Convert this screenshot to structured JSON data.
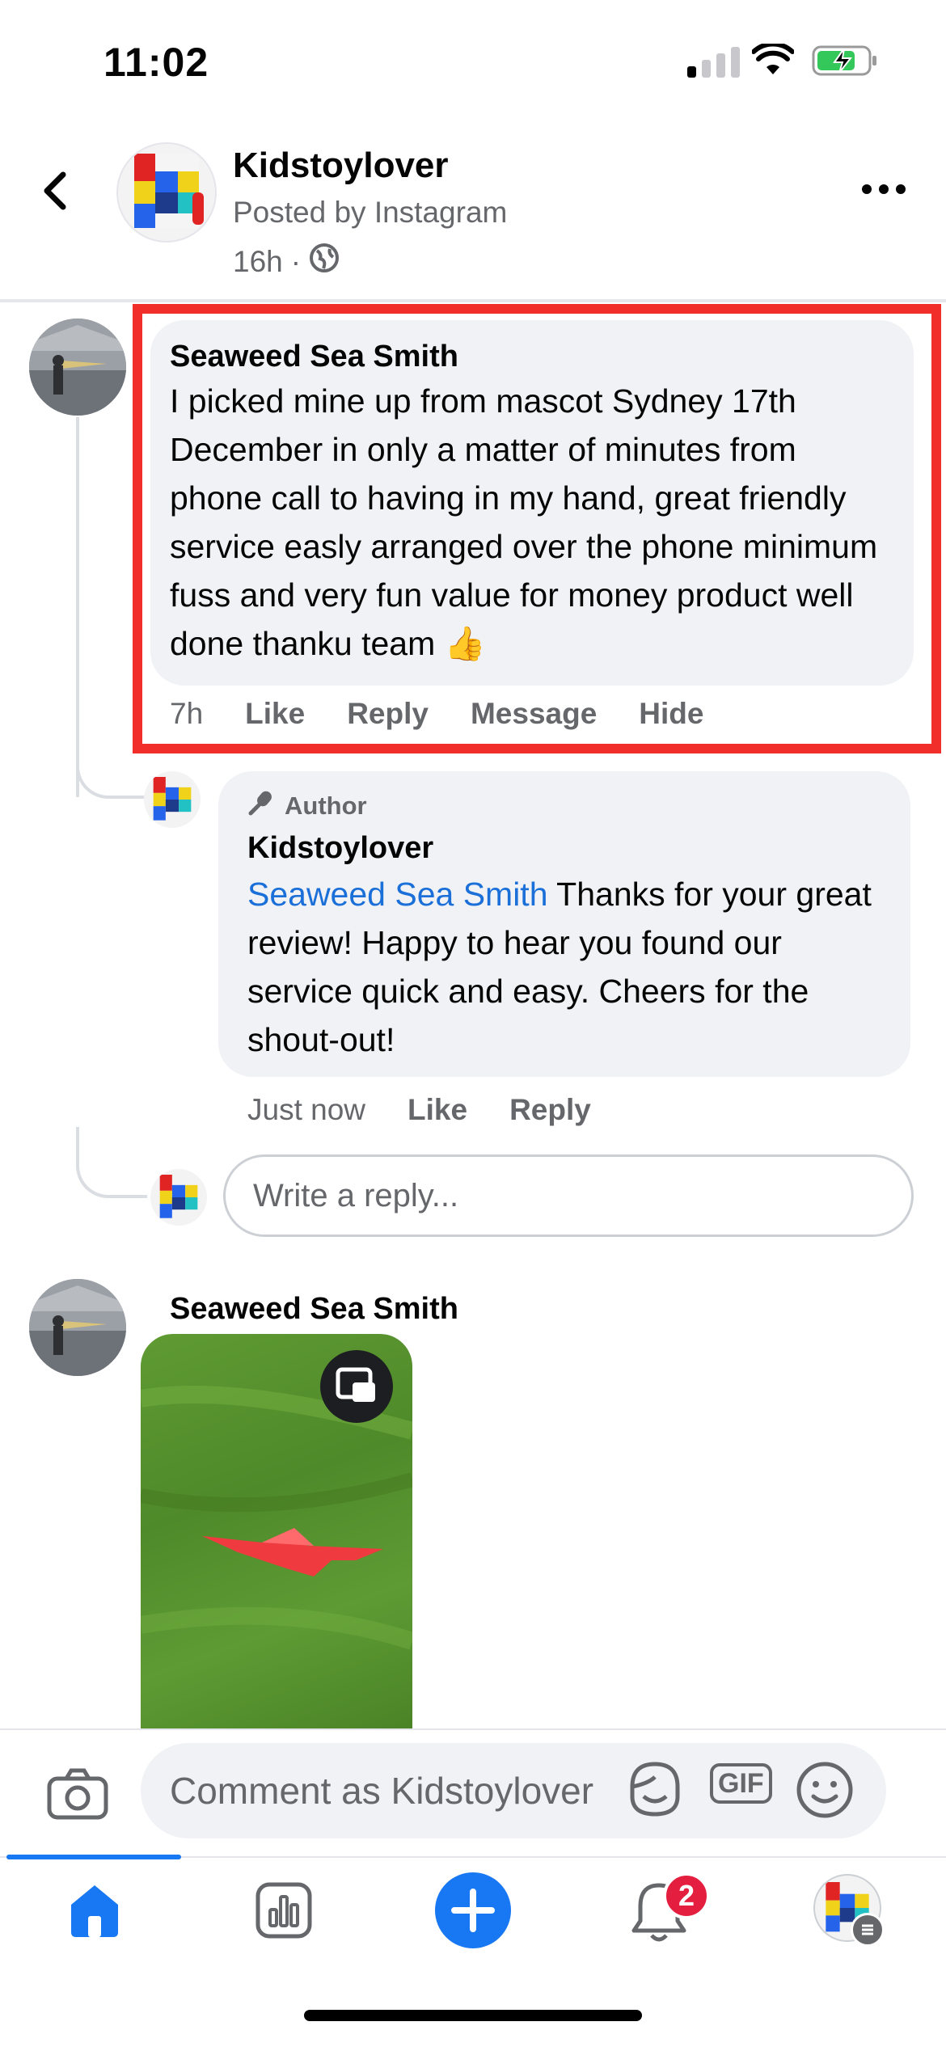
{
  "status_bar": {
    "time": "11:02"
  },
  "header": {
    "page_name": "Kidstoylover",
    "posted_by": "Posted by Instagram",
    "time": "16h",
    "separator": "·"
  },
  "comments": [
    {
      "author": "Seaweed Sea Smith",
      "text": "I picked mine up from mascot Sydney 17th December in only a matter of minutes from phone call to having in my hand, great friendly service easly arranged over the phone minimum fuss and very fun value for money product well done thanku team 👍",
      "time": "7h",
      "actions": [
        "Like",
        "Reply",
        "Message",
        "Hide"
      ]
    },
    {
      "author_tag": "Author",
      "author": "Kidstoylover",
      "mention": "Seaweed Sea Smith",
      "text": " Thanks for your great review! Happy to hear you found our service quick and easy. Cheers for the shout-out!",
      "time": "Just now",
      "actions": [
        "Like",
        "Reply"
      ]
    },
    {
      "author": "Seaweed Sea Smith"
    }
  ],
  "reply_input": {
    "placeholder": "Write a reply..."
  },
  "composer": {
    "placeholder": "Comment as Kidstoylover",
    "gif_label": "GIF"
  },
  "tabbar": {
    "notifications_count": "2"
  },
  "colors": {
    "accent": "#1877f2",
    "highlight": "#f22e2a",
    "badge": "#e41e3f"
  }
}
